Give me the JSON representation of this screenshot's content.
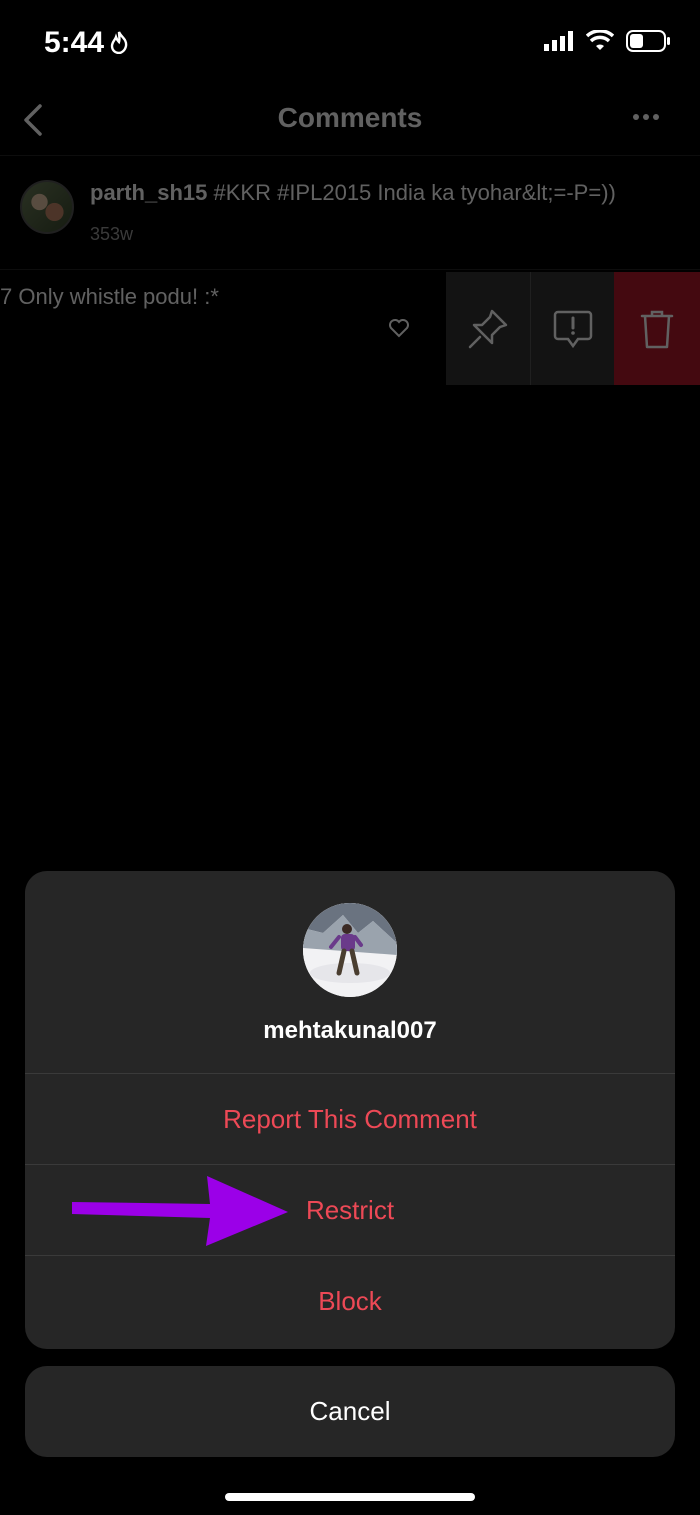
{
  "status_bar": {
    "time": "5:44"
  },
  "nav": {
    "title": "Comments"
  },
  "caption": {
    "username": "parth_sh15",
    "text": " #KKR #IPL2015 India ka tyohar&lt;=-P=))",
    "age": "353w"
  },
  "comment": {
    "text": "7 Only whistle podu! :*"
  },
  "action_sheet": {
    "username": "mehtakunal007",
    "options": [
      {
        "label": "Report This Comment"
      },
      {
        "label": "Restrict"
      },
      {
        "label": "Block"
      }
    ],
    "cancel_label": "Cancel"
  },
  "colors": {
    "destructive": "#ed4956",
    "delete_bg": "#b3182a",
    "annotation_arrow": "#9b00e8",
    "sheet_bg": "#262626"
  }
}
